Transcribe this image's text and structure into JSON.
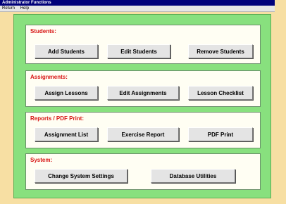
{
  "window": {
    "title": "Administrator Functions"
  },
  "menu": {
    "items": [
      "Return",
      "Help"
    ]
  },
  "sections": {
    "students": {
      "title": "Students:",
      "buttons": [
        "Add Students",
        "Edit Students",
        "Remove Students"
      ]
    },
    "assignments": {
      "title": "Assignments:",
      "buttons": [
        "Assign Lessons",
        "Edit Assignments",
        "Lesson Checklist"
      ]
    },
    "reports": {
      "title": "Reports / PDF Print:",
      "buttons": [
        "Assignment List",
        "Exercise Report",
        "PDF Print"
      ]
    },
    "system": {
      "title": "System:",
      "buttons": [
        "Change System Settings",
        "Database Utilities"
      ]
    }
  },
  "colors": {
    "desktop": "#f7dfa3",
    "panel": "#88e07e",
    "group_background": "#fffef3",
    "section_title": "#d81414",
    "titlebar": "#00007a"
  }
}
